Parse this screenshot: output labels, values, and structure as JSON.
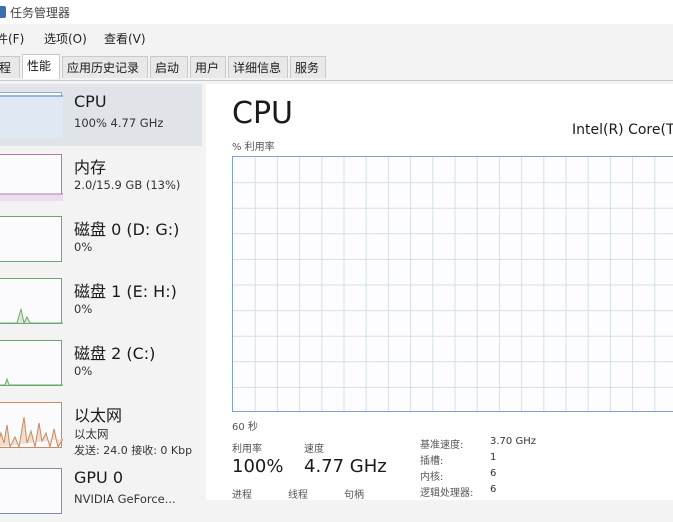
{
  "window": {
    "title": "任务管理器"
  },
  "menu": [
    "件(F)",
    "选项(O)",
    "查看(V)"
  ],
  "tabs": [
    {
      "label": "程",
      "active": false
    },
    {
      "label": "性能",
      "active": true
    },
    {
      "label": "应用历史记录",
      "active": false
    },
    {
      "label": "启动",
      "active": false
    },
    {
      "label": "用户",
      "active": false
    },
    {
      "label": "详细信息",
      "active": false
    },
    {
      "label": "服务",
      "active": false
    }
  ],
  "sidebar": {
    "items": [
      {
        "name": "CPU",
        "sub": "100% 4.77 GHz",
        "selected": true
      },
      {
        "name": "内存",
        "sub": "2.0/15.9 GB (13%)"
      },
      {
        "name": "磁盘 0 (D: G:)",
        "sub": "0%"
      },
      {
        "name": "磁盘 1 (E: H:)",
        "sub": "0%"
      },
      {
        "name": "磁盘 2 (C:)",
        "sub": "0%"
      },
      {
        "name": "以太网",
        "sub": "以太网",
        "sub2": "发送: 24.0  接收: 0 Kbp"
      },
      {
        "name": "GPU 0",
        "sub": "NVIDIA GeForce..."
      }
    ]
  },
  "main": {
    "title": "CPU",
    "processor": "Intel(R) Core(TM",
    "util_label": "% 利用率",
    "time_label": "60 秒",
    "utilization": {
      "label": "利用率",
      "value": "100%"
    },
    "speed": {
      "label": "速度",
      "value": "4.77 GHz"
    },
    "bottom_labels": [
      "进程",
      "线程",
      "句柄"
    ],
    "specs": [
      {
        "key": "基准速度:",
        "value": "3.70 GHz"
      },
      {
        "key": "插槽:",
        "value": "1"
      },
      {
        "key": "内核:",
        "value": "6"
      },
      {
        "key": "逻辑处理器:",
        "value": "6"
      }
    ]
  },
  "colors": {
    "cpu": "#7fa2c9",
    "memory": "#b17ab5",
    "disk": "#6fa86b",
    "ethernet": "#c68b5f"
  }
}
